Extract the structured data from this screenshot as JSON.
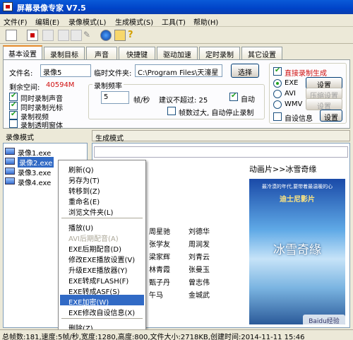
{
  "window": {
    "title": "屏幕录像专家 V7.5"
  },
  "menu": [
    "文件(F)",
    "编辑(E)",
    "录像模式(L)",
    "生成模式(S)",
    "工具(T)",
    "帮助(H)"
  ],
  "tabs": [
    "基本设置",
    "录制目标",
    "声音",
    "快捷键",
    "驱动加速",
    "定时录制",
    "其它设置"
  ],
  "basic": {
    "filename_label": "文件名:",
    "filename_value": "录像5",
    "tempdir_label": "临时文件夹:",
    "tempdir_value": "C:\\Program Files\\天濠星",
    "choose_button": "选择",
    "free_space_label": "剩余空间:",
    "free_space_value": "40594M",
    "chk_sound": "同时录制声音",
    "chk_cursor": "同时录制光标",
    "chk_video": "录制视频",
    "chk_transparent": "录制透明窗体",
    "fps_group": "录制频率",
    "fps_value": "5",
    "fps_unit": "帧/秒",
    "fps_hint": "建议不超过: 25",
    "auto_label": "自动",
    "autoadjust_label": "帧数过大, 自动停止录制",
    "direct_label": "直接录制生成",
    "exe_label": "EXE",
    "avi_label": "AVI",
    "wmv_label": "WMV",
    "settings_label": "设置",
    "compress_label": "压缩设置",
    "settings2_label": "设置",
    "selfinfo_label": "自设信息",
    "settings3_label": "设置"
  },
  "lower": {
    "left_header": "录像模式",
    "right_header": "生成模式",
    "files": [
      "录像1.exe",
      "录像2.exe",
      "录像3.exe",
      "录像4.exe"
    ],
    "breadcrumb": "动画片>>冰雪奇缘",
    "poster_small": "最冷漠的年代,要带着最温暖的心",
    "poster_brand": "迪士尼影片",
    "poster_title": "冰雪奇緣",
    "names": [
      "周星驰",
      "刘德华",
      "张学友",
      "周润发",
      "梁家辉",
      "刘青云",
      "林青霞",
      "张曼玉",
      "甄子丹",
      "曾志伟",
      "午马",
      "金城武"
    ],
    "watermark": "Baidu经验"
  },
  "context_menu": [
    {
      "label": "刷新(Q)",
      "enabled": true
    },
    {
      "label": "另存为(T)",
      "enabled": true
    },
    {
      "label": "转移到(Z)",
      "enabled": true
    },
    {
      "label": "重命名(E)",
      "enabled": true
    },
    {
      "label": "浏览文件夹(L)",
      "enabled": true
    },
    {
      "label": "播放(U)",
      "enabled": true
    },
    {
      "label": "AVI后期配音(A)",
      "enabled": false
    },
    {
      "label": "EXE后期配音(D)",
      "enabled": true
    },
    {
      "label": "修改EXE播放设置(V)",
      "enabled": true
    },
    {
      "label": "升级EXE播放器(Y)",
      "enabled": true
    },
    {
      "label": "EXE转成FLASH(F)",
      "enabled": true
    },
    {
      "label": "EXE转成ASF(S)",
      "enabled": true
    },
    {
      "label": "EXE加密(W)",
      "enabled": true,
      "highlighted": true
    },
    {
      "label": "EXE修改自设信息(X)",
      "enabled": true
    },
    {
      "label": "删除(Z)",
      "enabled": true
    }
  ],
  "status": "总帧数:181,速度:5帧/秒,宽度:1280,高度:800,文件大小:2718KB,创建时间:2014-11-11 15:46",
  "colors": {
    "accent_red": "#d01010",
    "selection": "#316ac5",
    "free_space": "#d01010"
  }
}
